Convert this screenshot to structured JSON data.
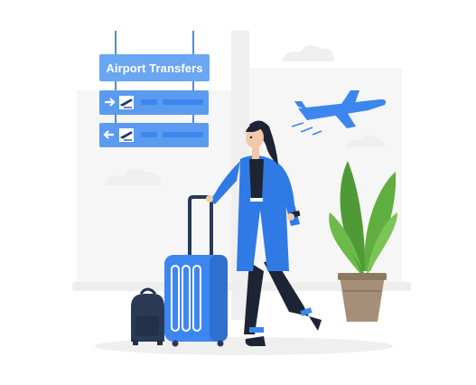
{
  "sign": {
    "title": "Airport Transfers"
  },
  "colors": {
    "accent_blue": "#3d86f0",
    "sign_blue": "#5a9bf0",
    "sign_title_bg": "#6aa6f2",
    "ghost_gray": "#f3f3f3",
    "plant_green": "#5aa03c",
    "luggage_blue": "#2f7ae5",
    "backpack_navy": "#2a3a55"
  },
  "icons": {
    "plane": "airplane-icon",
    "departures": "departure-icon",
    "arrow_right": "arrow-right-icon",
    "arrow_left": "arrow-left-icon"
  }
}
